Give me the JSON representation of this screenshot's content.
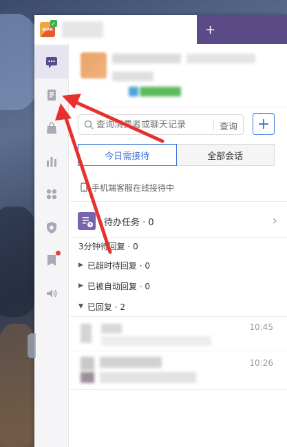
{
  "window": {
    "tab_add_label": "+"
  },
  "app_logo": {
    "text": "QIAN",
    "check": "✓"
  },
  "sidebar": {
    "items": [
      {
        "name": "messages",
        "icon": "chat-bubble-icon",
        "active": true
      },
      {
        "name": "orders",
        "icon": "document-icon",
        "active": false
      },
      {
        "name": "goods",
        "icon": "shopping-bag-icon",
        "active": false
      },
      {
        "name": "stats",
        "icon": "bar-chart-icon",
        "active": false
      },
      {
        "name": "apps",
        "icon": "grid-icon",
        "active": false
      },
      {
        "name": "security",
        "icon": "shield-icon",
        "active": false
      },
      {
        "name": "notes",
        "icon": "bookmark-icon",
        "active": false,
        "badge": true
      },
      {
        "name": "sound",
        "icon": "speaker-icon",
        "active": false
      }
    ]
  },
  "search": {
    "placeholder": "查询消费者或聊天记录",
    "button_label": "查询",
    "add_label": "+"
  },
  "tabs": {
    "today": "今日需接待",
    "all": "全部会话"
  },
  "mobile_status": "手机端客服在线接待中",
  "todo": {
    "label": "待办任务 · 0"
  },
  "groups": {
    "three_min": "3分钟待回复 · 0",
    "timeout": "已超时待回复 · 0",
    "auto": "已被自动回复 · 0",
    "replied": "已回复 · 2"
  },
  "conversations": [
    {
      "time": "10:45"
    },
    {
      "time": "10:26"
    }
  ],
  "colors": {
    "accent": "#3b73d9",
    "tab_bar": "#5a4a86",
    "todo_icon": "#7864ad",
    "annotation_arrow": "#e8312f"
  }
}
